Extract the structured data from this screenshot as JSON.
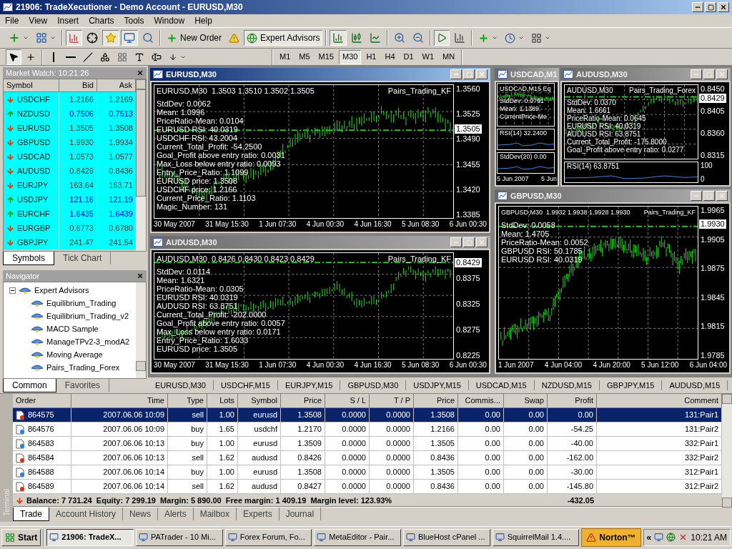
{
  "window": {
    "title": "21906: TradeXecutioner - Demo Account - EURUSD,M30"
  },
  "menu": [
    "File",
    "View",
    "Insert",
    "Charts",
    "Tools",
    "Window",
    "Help"
  ],
  "toolbar": {
    "new_order": "New Order",
    "expert_advisors": {
      "label": "Expert Advisors",
      "selected": true
    },
    "timeframes": [
      {
        "label": "M1",
        "selected": false
      },
      {
        "label": "M5",
        "selected": false
      },
      {
        "label": "M15",
        "selected": false
      },
      {
        "label": "M30",
        "selected": true
      },
      {
        "label": "H1",
        "selected": false
      },
      {
        "label": "H4",
        "selected": false
      },
      {
        "label": "D1",
        "selected": false
      },
      {
        "label": "W1",
        "selected": false
      },
      {
        "label": "MN",
        "selected": false
      }
    ]
  },
  "market_watch": {
    "title": "Market Watch: 10:21:26",
    "columns": [
      "Symbol",
      "Bid",
      "Ask"
    ],
    "rows": [
      {
        "symbol": "USDCHF",
        "bid": "1.2166",
        "ask": "1.2169",
        "kind": "down"
      },
      {
        "symbol": "NZDUSD",
        "bid": "0.7506",
        "ask": "0.7513",
        "kind": "up"
      },
      {
        "symbol": "EURUSD",
        "bid": "1.3505",
        "ask": "1.3508",
        "kind": "down"
      },
      {
        "symbol": "GBPUSD",
        "bid": "1.9930",
        "ask": "1.9934",
        "kind": "down"
      },
      {
        "symbol": "USDCAD",
        "bid": "1.0573",
        "ask": "1.0577",
        "kind": "down"
      },
      {
        "symbol": "AUDUSD",
        "bid": "0.8429",
        "ask": "0.8436",
        "kind": "down"
      },
      {
        "symbol": "EURJPY",
        "bid": "163.64",
        "ask": "163.71",
        "kind": "down"
      },
      {
        "symbol": "USDJPY",
        "bid": "121.16",
        "ask": "121.19",
        "kind": "up"
      },
      {
        "symbol": "EURCHF",
        "bid": "1.6435",
        "ask": "1.6439",
        "kind": "up"
      },
      {
        "symbol": "EURGBP",
        "bid": "0.6773",
        "ask": "0.6780",
        "kind": "down"
      },
      {
        "symbol": "GBPJPY",
        "bid": "241.47",
        "ask": "241.54",
        "kind": "down"
      }
    ],
    "tabs": [
      {
        "label": "Symbols",
        "selected": true
      },
      {
        "label": "Tick Chart",
        "selected": false
      }
    ]
  },
  "navigator": {
    "title": "Navigator",
    "tree": [
      {
        "label": "Expert Advisors",
        "expanded": true,
        "children": [
          {
            "label": "Equilibrium_Trading"
          },
          {
            "label": "Equilibrium_Trading_v2"
          },
          {
            "label": "MACD Sample"
          },
          {
            "label": "ManageTPv2-3_modA2"
          },
          {
            "label": "Moving Average"
          },
          {
            "label": "Pairs_Trading_Forex"
          }
        ]
      }
    ],
    "tabs": [
      {
        "label": "Common",
        "selected": true
      },
      {
        "label": "Favorites",
        "selected": false
      }
    ]
  },
  "charts": [
    {
      "title": "EURUSD,M30",
      "active": true,
      "header": "EURUSD,M30  1.3503 1.3510 1.3502 1.3505",
      "indicator": "Pairs_Trading_KF",
      "lines": [
        "StdDev: 0.0062",
        "Mean: 1.0996",
        "PriceRatio-Mean: 0.0104",
        "EURUSD RSI: 40.0319",
        "USDCHF RSI: 43.2004",
        "Current_Total_Profit: -54.2500",
        "Goal_Profit above entry ratio: 0.0031",
        "Max_Loss below entry ratio: 0.0093",
        "Entry_Price_Ratio: 1.1099",
        "EURUSD price: 1.3508",
        "USDCHF price: 1.2166",
        "Current_Price_Ratio: 1.1103",
        "Magic_Number: 131"
      ],
      "price_ticks": [
        "1.3560",
        "1.3525",
        "1.3490",
        "1.3455",
        "1.3420",
        "1.3385"
      ],
      "current_price": "1.3505",
      "time_labels": [
        "30 May 2007",
        "31 May 15:30",
        "1 Jun 07:30",
        "4 Jun 00:30",
        "4 Jun 16:30",
        "5 Jun 08:30",
        "6 Jun 00:30"
      ]
    },
    {
      "title": "AUDUSD,M30",
      "active": false,
      "header": "AUDUSD,M30  0.8426 0.8430 0.8423 0.8429",
      "indicator": "Pairs_Trading_KF",
      "lines": [
        "StdDev: 0.0114",
        "Mean: 1.6321",
        "PriceRatio-Mean: 0.0305",
        "EURUSD RSI: 40.0319",
        "AUDUSD RSI: 63.8751",
        "Current_Total_Profit: -202.0000",
        "Goal_Profit above entry ratio: 0.0057",
        "Max_Loss below entry ratio: 0.0171",
        "Entry_Price_Ratio: 1.6033",
        "EURUSD price: 1.3505"
      ],
      "price_ticks": [
        "0.8375",
        "0.8325",
        "0.8275",
        "0.8225"
      ],
      "current_price": "0.8429",
      "time_labels": [
        "30 May 2007",
        "31 May 15:30",
        "1 Jun 07:30",
        "4 Jun 00:30",
        "4 Jun 16:30",
        "5 Jun 08:30",
        "6 Jun 00:30"
      ]
    },
    {
      "title": "USDCAD,M1",
      "active": false,
      "header": "USDCAD,M15 Eq",
      "lines": [
        "StdDev: 0.0791",
        "Mean: 1.1389",
        "CurrentPrice-Me"
      ],
      "subpanes": [
        {
          "label": "RSI(14) 32.2400"
        },
        {
          "label": "StdDev(20) 0.00"
        }
      ],
      "time_labels": [
        "5 Jun 2007",
        "5 Jun"
      ]
    },
    {
      "title": "AUDUSD,M30",
      "active": false,
      "header": "AUDUSD,M30",
      "indicator": "Pairs_Trading_Forex",
      "lines": [
        "StdDev: 0.0370",
        "Mean: 1.6661",
        "PriceRatio-Mean: 0.0645",
        "EURUSD RSI: 40.0319",
        "AUDUSD RSI: 63.8751",
        "Current_Total_Profit: -175.8000",
        "Goal_Profit above entry ratio: 0.0277"
      ],
      "price_ticks": [
        "0.8450",
        "0.8405",
        "0.8360",
        "0.8315"
      ],
      "current_price": "0.8429",
      "subpanes": [
        {
          "label": "RSI(14) 63.8751",
          "scale": [
            "100",
            "0"
          ]
        }
      ]
    },
    {
      "title": "GBPUSD,M30",
      "active": false,
      "header": "GBPUSD,M30  1.9932 1.9938 1.9928 1.9930",
      "indicator": "Pairs_Trading_KF",
      "lines": [
        "StdDev: 0.0058",
        "Mean: 1.4705",
        "PriceRatio-Mean: 0.0052",
        "GBPUSD RSI: 50.1785",
        "EURUSD RSI: 40.0319"
      ],
      "price_ticks": [
        "1.9965",
        "1.9905",
        "1.9875",
        "1.9845",
        "1.9815",
        "1.9785"
      ],
      "current_price": "1.9930",
      "time_labels": [
        "1 Jun 2007",
        "4 Jun 04:00",
        "4 Jun 20:00",
        "5 Jun 12:00",
        "6 Jun 04:00"
      ]
    }
  ],
  "chart_tabs": [
    "EURUSD,M30",
    "USDCHF,M15",
    "EURJPY,M15",
    "GBPUSD,M30",
    "USDJPY,M15",
    "USDCAD,M15",
    "NZDUSD,M15",
    "GBPJPY,M15",
    "AUDUSD,M15"
  ],
  "terminal": {
    "label": "Terminal",
    "columns": [
      "Order",
      "Time",
      "Type",
      "Lots",
      "Symbol",
      "Price",
      "S / L",
      "T / P",
      "Price",
      "Commis...",
      "Swap",
      "Profit",
      "Comment"
    ],
    "rows": [
      {
        "kind": "sell",
        "selected": true,
        "cells": [
          "864575",
          "2007.06.06 10:09",
          "sell",
          "1.00",
          "eurusd",
          "1.3508",
          "0.0000",
          "0.0000",
          "1.3508",
          "0.00",
          "0.00",
          "0.00",
          "131:Pair1"
        ]
      },
      {
        "kind": "buy",
        "selected": false,
        "cells": [
          "864576",
          "2007.06.06 10:09",
          "buy",
          "1.65",
          "usdchf",
          "1.2170",
          "0.0000",
          "0.0000",
          "1.2166",
          "0.00",
          "0.00",
          "-54.25",
          "131:Pair2"
        ]
      },
      {
        "kind": "buy",
        "selected": false,
        "cells": [
          "864583",
          "2007.06.06 10:13",
          "buy",
          "1.00",
          "eurusd",
          "1.3509",
          "0.0000",
          "0.0000",
          "1.3505",
          "0.00",
          "0.00",
          "-40.00",
          "332:Pair1"
        ]
      },
      {
        "kind": "sell",
        "selected": false,
        "cells": [
          "864584",
          "2007.06.06 10:13",
          "sell",
          "1.62",
          "audusd",
          "0.8426",
          "0.0000",
          "0.0000",
          "0.8436",
          "0.00",
          "0.00",
          "-162.00",
          "332:Pair2"
        ]
      },
      {
        "kind": "buy",
        "selected": false,
        "cells": [
          "864588",
          "2007.06.06 10:14",
          "buy",
          "1.00",
          "eurusd",
          "1.3508",
          "0.0000",
          "0.0000",
          "1.3505",
          "0.00",
          "0.00",
          "-30.00",
          "312:Pair1"
        ]
      },
      {
        "kind": "sell",
        "selected": false,
        "cells": [
          "864589",
          "2007.06.06 10:14",
          "sell",
          "1.62",
          "audusd",
          "0.8427",
          "0.0000",
          "0.0000",
          "0.8436",
          "0.00",
          "0.00",
          "-145.80",
          "312:Pair2"
        ]
      }
    ],
    "summary": "Balance: 7 731.24  Equity: 7 299.19  Margin: 5 890.00  Free margin: 1 409.19  Margin level: 123.93%",
    "total_profit": "-432.05",
    "tabs": [
      {
        "label": "Trade",
        "selected": true
      },
      {
        "label": "Account History",
        "selected": false
      },
      {
        "label": "News",
        "selected": false
      },
      {
        "label": "Alerts",
        "selected": false
      },
      {
        "label": "Mailbox",
        "selected": false
      },
      {
        "label": "Experts",
        "selected": false
      },
      {
        "label": "Journal",
        "selected": false
      }
    ]
  },
  "taskbar": {
    "start": "Start",
    "tasks": [
      {
        "label": "21906: TradeX...",
        "selected": true
      },
      {
        "label": "PATrader - 10 Mi...",
        "selected": false
      },
      {
        "label": "Forex Forum, Fo...",
        "selected": false
      },
      {
        "label": "MetaEditor - Pair...",
        "selected": false
      },
      {
        "label": "BlueHost cPanel ...",
        "selected": false
      },
      {
        "label": "SquirrelMail 1.4....",
        "selected": false
      }
    ],
    "norton": "Norton™",
    "chevron": "«",
    "clock": "10:21 AM"
  }
}
